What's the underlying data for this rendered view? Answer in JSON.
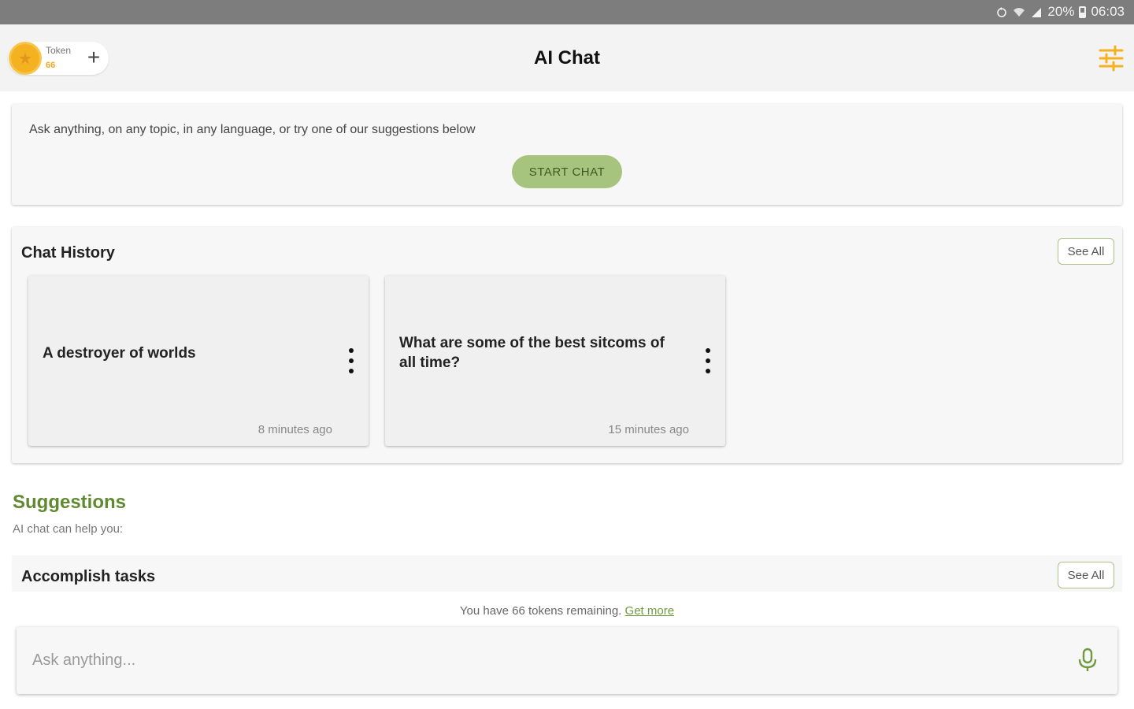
{
  "status_bar": {
    "battery": "20%",
    "time": "06:03",
    "icons": [
      "sync-icon",
      "wifi-icon",
      "signal-icon",
      "battery-icon"
    ]
  },
  "header": {
    "token_label": "Token",
    "token_count": "66",
    "add_icon": "plus-icon",
    "title": "AI Chat",
    "filter_icon": "tune-icon"
  },
  "intro": {
    "text": "Ask anything, on any topic, in any language, or try one of our suggestions below",
    "start_button": "START CHAT"
  },
  "history": {
    "title": "Chat History",
    "see_all": "See All",
    "items": [
      {
        "title": "A destroyer of worlds",
        "time": "8 minutes ago"
      },
      {
        "title": "What are some of the best sitcoms of all time?",
        "time": "15 minutes ago"
      }
    ]
  },
  "suggestions": {
    "title": "Suggestions",
    "subtitle": "AI chat can help you:",
    "first_category": "Accomplish tasks",
    "see_all": "See All"
  },
  "footer": {
    "remaining_text": "You have 66 tokens remaining.",
    "get_more": "Get more",
    "input_placeholder": "Ask anything...",
    "mic_icon": "microphone-icon"
  },
  "colors": {
    "accent_green": "#6f9a3e",
    "button_green": "#a7c47e",
    "coin_gold": "#f4b120",
    "status_bar": "#7d7d7d"
  }
}
